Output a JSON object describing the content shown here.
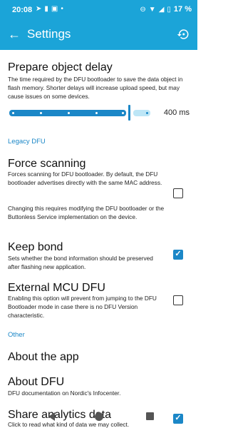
{
  "status_bar": {
    "time": "20:08",
    "battery": "17 %"
  },
  "app_bar": {
    "title": "Settings"
  },
  "prepare_delay": {
    "title": "Prepare object delay",
    "description": "The time required by the DFU bootloader to save the data object in flash memory. Shorter delays will increase upload speed, but may cause issues on some devices.",
    "slider_value": "400 ms",
    "slider_fraction": 0.85
  },
  "legacy_section": "Legacy DFU",
  "force_scanning": {
    "title": "Force scanning",
    "description1": "Forces scanning for DFU bootloader. By default, the DFU bootloader advertises directly with the same MAC address.",
    "description2": "Changing this requires modifying the DFU bootloader or the Buttonless Service implementation on the device.",
    "checked": false
  },
  "keep_bond": {
    "title": "Keep bond",
    "description": "Sets whether the bond information should be preserved after flashing new application.",
    "checked": true
  },
  "external_mcu": {
    "title": "External MCU DFU",
    "description": "Enabling this option will prevent from jumping to the DFU Bootloader mode in case there is no DFU Version characteristic.",
    "checked": false
  },
  "other_section": "Other",
  "about_app": {
    "title": "About the app"
  },
  "about_dfu": {
    "title": "About DFU",
    "description": "DFU documentation on Nordic's Infocenter."
  },
  "share_analytics": {
    "title": "Share analytics data",
    "description": "Click to read what kind of data we may collect.",
    "checked": true
  },
  "colors": {
    "primary": "#1ba4d8",
    "accent": "#1b87c7"
  }
}
